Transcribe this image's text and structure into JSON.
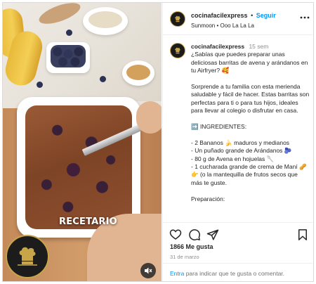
{
  "media": {
    "overlay_text": "RECETARIO",
    "mute_icon": "speaker-muted-icon",
    "logo_icon": "chef-logo-icon"
  },
  "header": {
    "username": "cocinafacilexpress",
    "separator": "•",
    "follow_label": "Seguir",
    "audio": "Sunmoon • Ooo La La La",
    "more_icon": "more-options-icon"
  },
  "caption": {
    "username": "cocinafacilexpress",
    "time": "15 sem",
    "paragraphs": [
      "¿Sabías que puedes preparar unas deliciosas barritas de avena y arándanos en tu Airfryer? 🥰",
      "",
      "Sorprende a tu familia con esta merienda saludable y fácil de hacer. Estas barritas son perfectas para ti o para tus hijos, ideales para llevar al colegio o disfrutar en casa.",
      "",
      "➡️ INGREDIENTES:",
      "",
      "- 2 Bananos 🍌 maduros y medianos",
      "- Un puñado grande de Arándanos 🫐",
      "- 80 g de Avena en hojuelas 🥄",
      "- 1 cucharada grande de crema de Maní 🥜 👉 (o la mantequilla de frutos secos que más te guste.",
      "",
      "Preparación:"
    ]
  },
  "actions": {
    "like_icon": "heart-icon",
    "comment_icon": "comment-icon",
    "share_icon": "share-icon",
    "save_icon": "bookmark-icon"
  },
  "likes": "1866 Me gusta",
  "date": "31 de marzo",
  "comment_bar": {
    "link": "Entra",
    "rest": " para indicar que te gusta o comentar."
  },
  "colors": {
    "link_blue": "#0095f6",
    "text": "#262626",
    "muted": "#8e8e8e",
    "logo_gold": "#c9a54a"
  }
}
